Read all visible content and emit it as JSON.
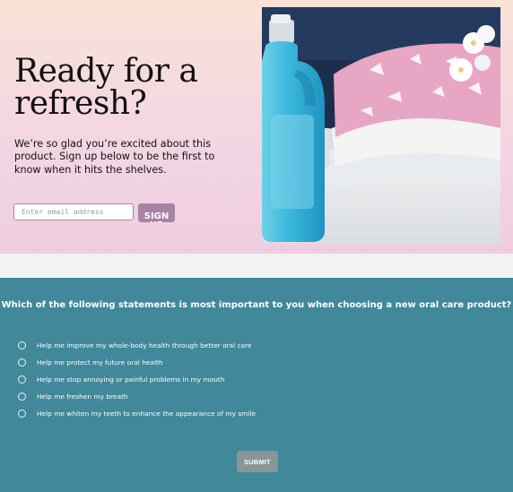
{
  "hero": {
    "title_line1": "Ready for a",
    "title_line2": "refresh?",
    "subtitle": "We’re so glad you’re excited about this product. Sign up below to be the first to know when it hits the shelves.",
    "email_placeholder": "Enter email address",
    "signup_label": "SIGN UP",
    "image_description_icon": "laundry-detergent-photo"
  },
  "survey": {
    "question": "Which of the following statements is most important to you when choosing a new oral care product?",
    "options": [
      "Help me improve my whole-body health through better oral care",
      "Help me protect my future oral health",
      "Help me stop annoying or painful problems in my mouth",
      "Help me freshen my breath",
      "Help me whiten my teeth to enhance the appearance of my smile"
    ],
    "submit_label": "SUBMIT"
  },
  "colors": {
    "survey_bg": "#40889a",
    "signup_bg": "#a784a5",
    "submit_bg": "#8a9597"
  }
}
